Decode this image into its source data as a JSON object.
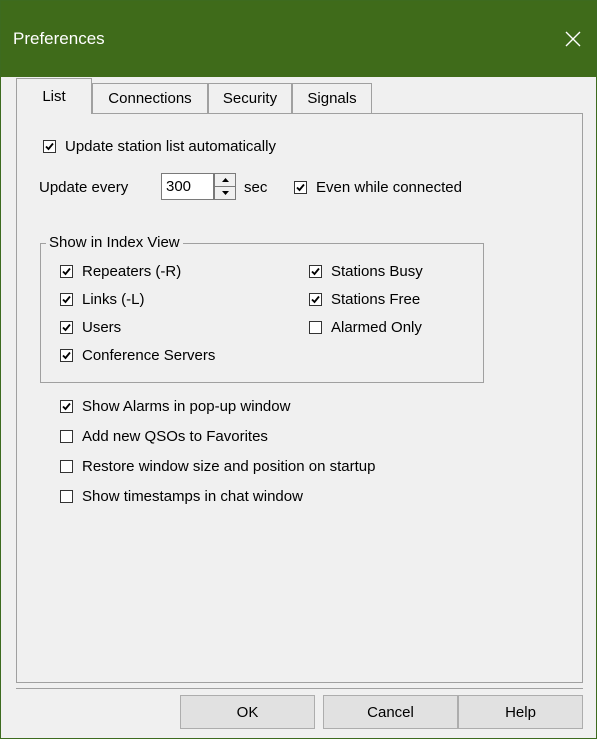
{
  "window": {
    "title": "Preferences",
    "close_icon": "close-icon"
  },
  "tabs": [
    {
      "label": "List",
      "active": true
    },
    {
      "label": "Connections",
      "active": false
    },
    {
      "label": "Security",
      "active": false
    },
    {
      "label": "Signals",
      "active": false
    }
  ],
  "list_tab": {
    "update_auto": {
      "label": "Update station list automatically",
      "checked": true
    },
    "update_every": {
      "label": "Update every",
      "value": "300",
      "unit": "sec"
    },
    "even_connected": {
      "label": "Even while connected",
      "checked": true
    },
    "index_view": {
      "title": "Show in Index View",
      "left": [
        {
          "label": "Repeaters (-R)",
          "checked": true
        },
        {
          "label": "Links (-L)",
          "checked": true
        },
        {
          "label": "Users",
          "checked": true
        },
        {
          "label": "Conference Servers",
          "checked": true
        }
      ],
      "right": [
        {
          "label": "Stations Busy",
          "checked": true
        },
        {
          "label": "Stations Free",
          "checked": true
        },
        {
          "label": "Alarmed Only",
          "checked": false
        }
      ]
    },
    "options": [
      {
        "label": "Show Alarms in pop-up window",
        "checked": true
      },
      {
        "label": "Add new QSOs to Favorites",
        "checked": false
      },
      {
        "label": "Restore window size and position on startup",
        "checked": false
      },
      {
        "label": "Show timestamps in chat window",
        "checked": false
      }
    ]
  },
  "buttons": {
    "ok": "OK",
    "cancel": "Cancel",
    "help": "Help"
  }
}
